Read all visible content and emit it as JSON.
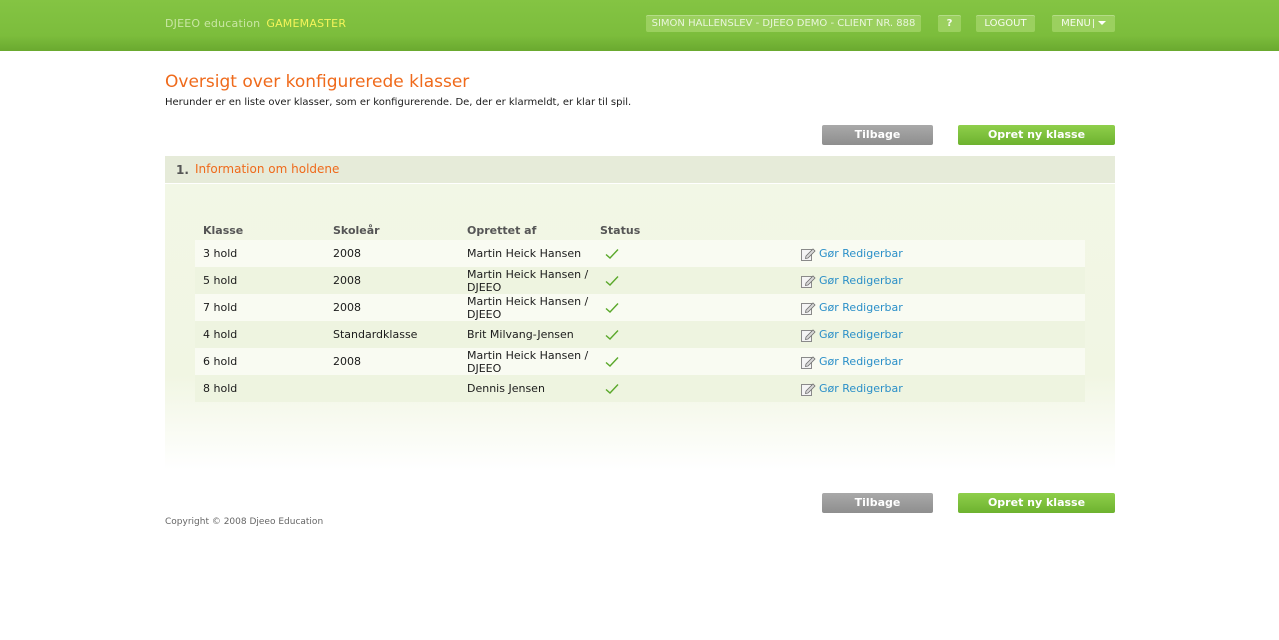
{
  "header": {
    "brand": "DJEEO education",
    "product": "GAMEMASTER",
    "user": "SIMON HALLENSLEV - DJEEO DEMO - CLIENT NR. 888",
    "help": "?",
    "logout": "LOGOUT",
    "menu": "MENU",
    "accent": "#7cbd3c"
  },
  "page": {
    "title": "Oversigt over konfigurerede klasser",
    "subtitle": "Herunder er en liste over klasser, som er konfigurerende. De, der er klarmeldt, er klar til spil.",
    "title_color": "#ef6a1b"
  },
  "buttons": {
    "back": "Tilbage",
    "create": "Opret ny klasse"
  },
  "section": {
    "number": "1.",
    "title": "Information om holdene"
  },
  "table": {
    "headers": [
      "Klasse",
      "Skoleår",
      "Oprettet af",
      "Status"
    ],
    "rows": [
      {
        "klasse": "3 hold",
        "skoleaar": "2008",
        "oprettet": "Martin Heick Hansen",
        "status": "check-icon",
        "action": "Gør Redigerbar"
      },
      {
        "klasse": "5 hold",
        "skoleaar": "2008",
        "oprettet": "Martin Heick Hansen / DJEEO",
        "status": "check-icon",
        "action": "Gør Redigerbar"
      },
      {
        "klasse": "7 hold",
        "skoleaar": "2008",
        "oprettet": "Martin Heick Hansen / DJEEO",
        "status": "check-icon",
        "action": "Gør Redigerbar"
      },
      {
        "klasse": "4 hold",
        "skoleaar": "Standardklasse",
        "oprettet": "Brit Milvang-Jensen",
        "status": "check-icon",
        "action": "Gør Redigerbar"
      },
      {
        "klasse": "6 hold",
        "skoleaar": "2008",
        "oprettet": "Martin Heick Hansen / DJEEO",
        "status": "check-icon",
        "action": "Gør Redigerbar"
      },
      {
        "klasse": "8 hold",
        "skoleaar": "",
        "oprettet": "Dennis Jensen",
        "status": "check-icon",
        "action": "Gør Redigerbar"
      }
    ]
  },
  "footer": {
    "copyright": "Copyright © 2008 Djeeo Education"
  }
}
